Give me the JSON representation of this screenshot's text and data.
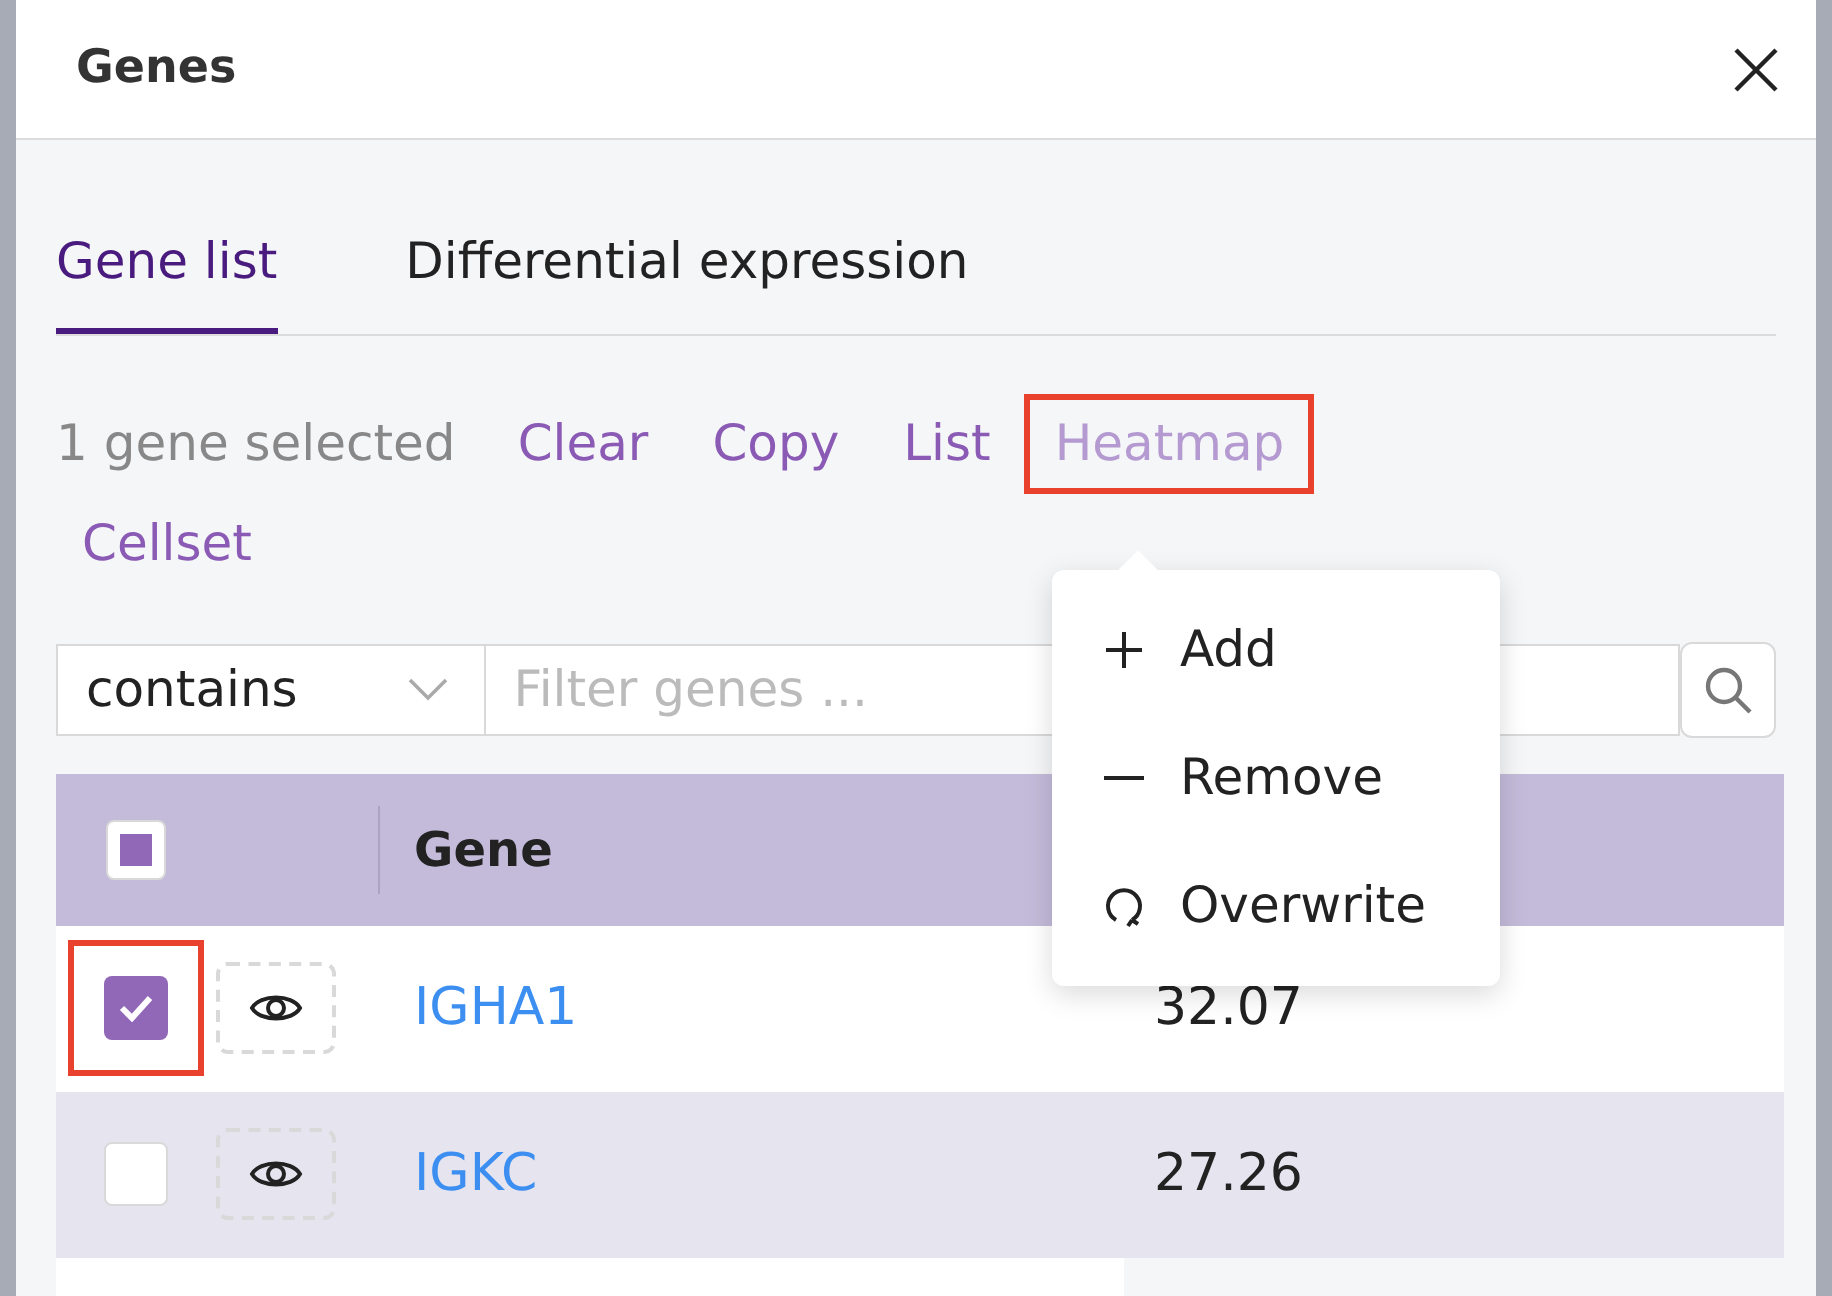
{
  "window": {
    "title": "Genes"
  },
  "tabs": [
    {
      "label": "Gene list",
      "selected": true
    },
    {
      "label": "Differential expression",
      "selected": false
    }
  ],
  "selection": {
    "summary": "1 gene selected",
    "actions": [
      {
        "label": "Clear",
        "highlighted": false,
        "disabled": false
      },
      {
        "label": "Copy",
        "highlighted": false,
        "disabled": false
      },
      {
        "label": "List",
        "highlighted": false,
        "disabled": false
      },
      {
        "label": "Heatmap",
        "highlighted": true,
        "disabled": true
      },
      {
        "label": "Cellset",
        "highlighted": false,
        "disabled": false
      }
    ]
  },
  "filter": {
    "mode": "contains",
    "placeholder": "Filter genes ..."
  },
  "menu": {
    "items": [
      {
        "label": "Add",
        "kind": "add"
      },
      {
        "label": "Remove",
        "kind": "remove"
      },
      {
        "label": "Overwrite",
        "kind": "overwrite"
      }
    ]
  },
  "table": {
    "columns": [
      "Gene"
    ],
    "select_all": {
      "indeterminate": true
    },
    "rows": [
      {
        "gene": "IGHA1",
        "value": "32.07",
        "checked": true,
        "highlighted": true
      },
      {
        "gene": "IGKC",
        "value": "27.26",
        "checked": false,
        "highlighted": false
      }
    ]
  }
}
